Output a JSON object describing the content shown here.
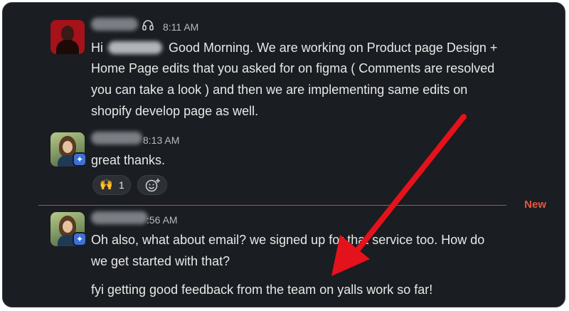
{
  "messages": [
    {
      "time": "8:11 AM",
      "lines": [
        "Hi ",
        " Good Morning. We are working on Product page Design +",
        "Home Page edits that you asked for on figma ( Comments are resolved",
        "you can take a look ) and then we are implementing same edits on",
        "shopify develop page as well."
      ]
    },
    {
      "time": "8:13 AM",
      "lines": [
        "great thanks."
      ],
      "reactions": [
        {
          "emoji": "🙌",
          "count": "1"
        }
      ]
    },
    {
      "time": "8:56 AM",
      "time_visible": ":56 AM",
      "lines": [
        "Oh also, what about email? we signed up for that service too. How do",
        "we get started with that?",
        "fyi getting good feedback from the team on yalls work so far!"
      ]
    }
  ],
  "divider": {
    "label": "New"
  },
  "colors": {
    "background": "#1a1d21",
    "divider": "#c64a32",
    "new_label": "#e2583e",
    "arrow": "#e3121b"
  },
  "icons": {
    "status": "headphones-icon",
    "badge": "sparkle-badge-icon",
    "add_reaction": "add-emoji-icon"
  }
}
